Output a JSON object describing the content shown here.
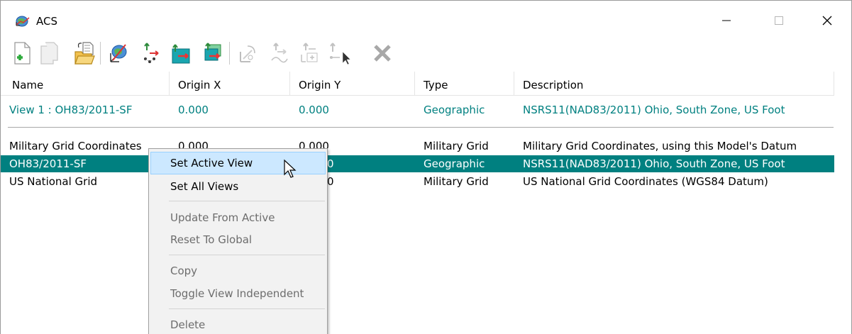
{
  "window": {
    "title": "ACS",
    "icon": "acs-globe-icon",
    "controls": {
      "minimize": "minimize-icon",
      "maximize": "maximize-icon",
      "close": "close-icon"
    }
  },
  "toolbar": {
    "buttons": [
      {
        "name": "new-acs",
        "icon": "new-document-plus-icon",
        "enabled": true
      },
      {
        "name": "copy-acs",
        "icon": "copy-icon",
        "enabled": false
      },
      {
        "name": "open-acs",
        "icon": "folder-open-icon",
        "enabled": true
      },
      {
        "name": "define-acs-by-element",
        "icon": "globe-axes-icon",
        "enabled": true
      },
      {
        "name": "define-acs-by-points",
        "icon": "points-axes-icon",
        "enabled": true
      },
      {
        "name": "set-view",
        "icon": "set-view-icon",
        "enabled": true
      },
      {
        "name": "set-all-views",
        "icon": "set-all-views-icon",
        "enabled": true
      },
      {
        "name": "rotate-acs",
        "icon": "rotate-axes-icon",
        "enabled": false
      },
      {
        "name": "move-acs",
        "icon": "move-axes-icon",
        "enabled": false
      },
      {
        "name": "select-acs",
        "icon": "select-axes-icon",
        "enabled": false
      },
      {
        "name": "identify-acs",
        "icon": "identify-cursor-icon",
        "enabled": false
      },
      {
        "name": "delete-acs",
        "icon": "delete-x-icon",
        "enabled": false
      }
    ]
  },
  "table": {
    "columns": [
      "Name",
      "Origin X",
      "Origin Y",
      "Type",
      "Description"
    ],
    "active_view_row": {
      "name": "View 1 : OH83/2011-SF",
      "origin_x": "0.000",
      "origin_y": "0.000",
      "type": "Geographic",
      "description": "NSRS11(NAD83/2011) Ohio, South Zone, US Foot"
    },
    "rows": [
      {
        "name": "Military Grid Coordinates",
        "origin_x": "0.000",
        "origin_y": "0.000",
        "type": "Military Grid",
        "description": "Military Grid Coordinates, using this Model's Datum",
        "selected": false
      },
      {
        "name": "OH83/2011-SF",
        "origin_x": "",
        "origin_y": "0",
        "type": "Geographic",
        "description": "NSRS11(NAD83/2011) Ohio, South Zone, US Foot",
        "selected": true
      },
      {
        "name": "US National Grid",
        "origin_x": "",
        "origin_y": "0",
        "type": "Military Grid",
        "description": "US National Grid Coordinates (WGS84 Datum)",
        "selected": false
      }
    ]
  },
  "context_menu": {
    "items": [
      {
        "label": "Set Active View",
        "enabled": true,
        "hover": true
      },
      {
        "label": "Set All Views",
        "enabled": true
      },
      {
        "label": "Update From Active",
        "enabled": false
      },
      {
        "label": "Reset To Global",
        "enabled": false
      },
      {
        "label": "Copy",
        "enabled": false
      },
      {
        "label": "Toggle View Independent",
        "enabled": false
      },
      {
        "label": "Delete",
        "enabled": false
      }
    ]
  },
  "colors": {
    "accent_teal": "#008080",
    "menu_hover": "#cce8ff",
    "disabled_text": "#6d6d6d"
  }
}
